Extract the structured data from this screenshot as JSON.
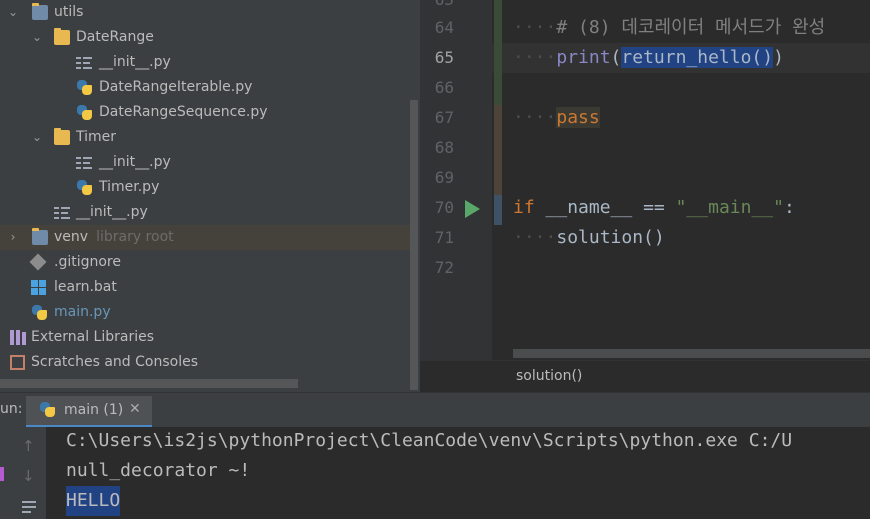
{
  "project_tree": {
    "items": [
      {
        "label": "utils",
        "arrow": "⌄",
        "icon": "folder-icon"
      },
      {
        "label": "DateRange",
        "arrow": "⌄",
        "icon": "folder-icon"
      },
      {
        "label": "__init__.py",
        "icon": "python-init-icon"
      },
      {
        "label": "DateRangeIterable.py",
        "icon": "python-file-icon"
      },
      {
        "label": "DateRangeSequence.py",
        "icon": "python-file-icon"
      },
      {
        "label": "Timer",
        "arrow": "⌄",
        "icon": "folder-icon"
      },
      {
        "label": "__init__.py",
        "icon": "python-init-icon"
      },
      {
        "label": "Timer.py",
        "icon": "python-file-icon"
      },
      {
        "label": "__init__.py",
        "icon": "python-init-icon"
      },
      {
        "label": "venv",
        "hint": "library root",
        "arrow": "›",
        "icon": "venv-folder-icon"
      },
      {
        "label": ".gitignore",
        "icon": "git-icon"
      },
      {
        "label": "learn.bat",
        "icon": "windows-icon"
      },
      {
        "label": "main.py",
        "icon": "python-file-icon"
      },
      {
        "label": "External Libraries",
        "icon": "library-icon"
      },
      {
        "label": "Scratches and Consoles",
        "icon": "scratches-icon"
      }
    ]
  },
  "editor": {
    "line_numbers": [
      "65",
      "64",
      "65",
      "66",
      "67",
      "68",
      "69",
      "70",
      "71",
      "72"
    ],
    "code": {
      "comment": "# (8) 데코레이터 메서드가 완성",
      "print_kw": "print",
      "print_open": "(",
      "print_selected": "return_hello()",
      "print_close": ")",
      "pass_kw": "pass",
      "if_kw": "if",
      "name_var": " __name__ ",
      "eq": "==",
      "main_str": "\"__main__\"",
      "colon": ":",
      "solution_call": "solution()"
    },
    "indent_dots": "····"
  },
  "breadcrumb": "solution()",
  "run_panel": {
    "label": "un:",
    "tab_label": "main (1)",
    "close_glyph": "✕",
    "console_lines": [
      "C:\\Users\\is2js\\pythonProject\\CleanCode\\venv\\Scripts\\python.exe C:/U",
      "null_decorator ~!",
      "HELLO"
    ]
  },
  "colors": {
    "accent": "#4a88c7",
    "selection": "#214283",
    "keyword": "#cc7832",
    "string": "#6a8759"
  }
}
